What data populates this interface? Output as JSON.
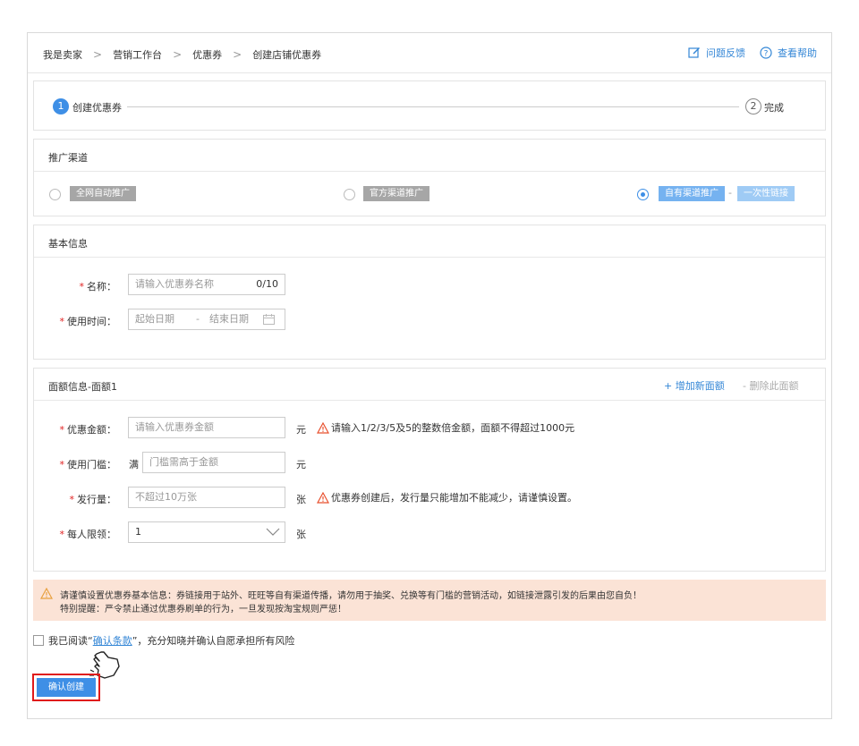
{
  "breadcrumb": [
    "我是卖家",
    "营销工作台",
    "优惠券",
    "创建店铺优惠券"
  ],
  "toplinks": {
    "feedback": "问题反馈",
    "help": "查看帮助"
  },
  "steps": [
    {
      "num": "1",
      "label": "创建优惠券"
    },
    {
      "num": "2",
      "label": "完成"
    }
  ],
  "channel": {
    "title": "推广渠道",
    "options": [
      {
        "label": "全网自动推广",
        "selected": false
      },
      {
        "label": "官方渠道推广",
        "selected": false
      },
      {
        "label": "自有渠道推广",
        "selected": true,
        "sublabel": "一次性链接"
      }
    ]
  },
  "basic": {
    "title": "基本信息",
    "name_label": "名称：",
    "name_placeholder": "请输入优惠券名称",
    "name_count": "0/10",
    "time_label": "使用时间：",
    "start_placeholder": "起始日期",
    "time_sep": "-",
    "end_placeholder": "结束日期"
  },
  "denom": {
    "title": "面额信息-面额1",
    "add": "+ 增加新面额",
    "delete": "- 删除此面额",
    "amount_label": "优惠金额：",
    "amount_placeholder": "请输入优惠券金额",
    "amount_unit": "元",
    "amount_warn": "请输入1/2/3/5及5的整数倍金额，面额不得超过1000元",
    "threshold_label": "使用门槛：",
    "threshold_prefix": "满",
    "threshold_placeholder": "门槛需高于金额",
    "threshold_unit": "元",
    "issue_label": "发行量：",
    "issue_placeholder": "不超过10万张",
    "issue_unit": "张",
    "issue_warn": "优惠券创建后，发行量只能增加不能减少，请谨慎设置。",
    "limit_label": "每人限领：",
    "limit_value": "1",
    "limit_unit": "张"
  },
  "notice": {
    "line1": "请谨慎设置优惠券基本信息：券链接用于站外、旺旺等自有渠道传播，请勿用于抽奖、兑换等有门槛的营销活动，如链接泄露引发的后果由您自负！",
    "line2": "特别提醒：严令禁止通过优惠券刷单的行为，一旦发现按淘宝规则严惩！"
  },
  "agree": {
    "prefix": "我已阅读“",
    "link": "确认条款",
    "suffix": "”，充分知晓并确认自愿承担所有风险"
  },
  "submit": "确认创建",
  "colors": {
    "accent": "#3e8fe6",
    "link": "#3386d6",
    "required": "#e02020",
    "warning": "#e8502e",
    "notice_bg": "#fbe3d6"
  }
}
